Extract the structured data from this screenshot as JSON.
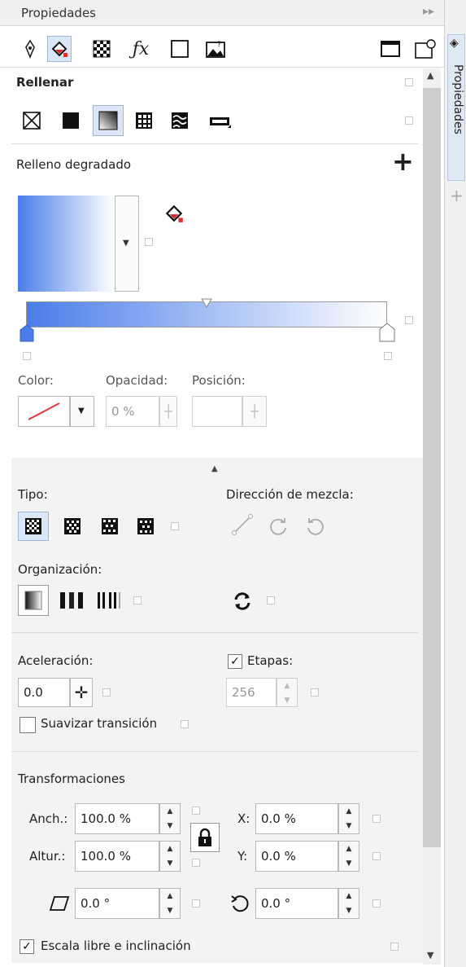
{
  "panel": {
    "title": "Propiedades",
    "side_tab": "Propiedades"
  },
  "fill": {
    "section_title": "Rellenar",
    "gradient_title": "Relleno degradado",
    "labels": {
      "color": "Color:",
      "opacity": "Opacidad:",
      "position": "Posición:"
    },
    "opacity_value": "0 %",
    "position_value": "",
    "start_color": "#4a7dea",
    "end_color": "#ffffff"
  },
  "type_section": {
    "type_label": "Tipo:",
    "blend_label": "Dirección de mezcla:",
    "arrangement_label": "Organización:"
  },
  "accel": {
    "label": "Aceleración:",
    "value": "0.0",
    "steps_label": "Etapas:",
    "steps_value": "256",
    "smooth_label": "Suavizar transición"
  },
  "transform": {
    "title": "Transformaciones",
    "width_label": "Anch.:",
    "width_value": "100.0 %",
    "height_label": "Altur.:",
    "height_value": "100.0 %",
    "x_label": "X:",
    "x_value": "0.0 %",
    "y_label": "Y:",
    "y_value": "0.0 %",
    "skew_value": "0.0 °",
    "rotate_value": "0.0 °",
    "free_scale_label": "Escala libre e inclinación"
  }
}
